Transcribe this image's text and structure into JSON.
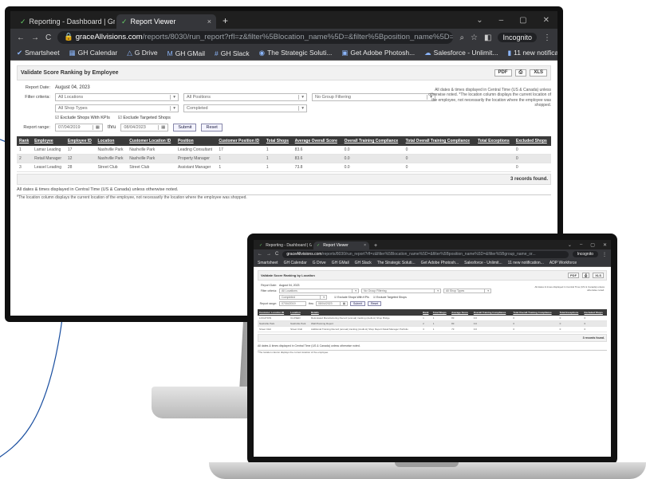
{
  "browser": {
    "tabs": [
      {
        "label": "Reporting - Dashboard | Grace I",
        "close": "×"
      },
      {
        "label": "Report Viewer",
        "close": "×"
      }
    ],
    "new_tab": "+",
    "window_controls": [
      "⌄",
      "–",
      "▢",
      "✕"
    ],
    "nav": {
      "back": "←",
      "forward": "→",
      "reload": "C"
    },
    "url_host": "graceAllvisions.com",
    "url_rest": "/reports/8030/run_report?rfl=z&filter%5Blocation_name%5D=&filter%5Bposition_name%5D=&filter%5Bgroup_name_or...",
    "incognito": "Incognito",
    "bookmarks": [
      "Smartsheet",
      "GH Calendar",
      "G Drive",
      "GH GMail",
      "GH Slack",
      "The Strategic Soluti...",
      "Get Adobe Photosh...",
      "Salesforce - Unlimit...",
      "11 new notification...",
      "ADP Workforce"
    ]
  },
  "monitor": {
    "title": "Validate Score Ranking by Employee",
    "title_buttons": [
      "PDF",
      "⎙",
      "XLS"
    ],
    "report_date_label": "Report Date:",
    "report_date": "August 04, 2023",
    "filter_label": "Filter criteria:",
    "filters": {
      "locations": "All Locations",
      "positions": "All Positions",
      "group": "No Group Filtering",
      "shop_types": "All Shop Types",
      "status": "Completed"
    },
    "checkboxes": [
      "Exclude Shops With KPIs",
      "Exclude Targeted Shops"
    ],
    "range_label": "Report range:",
    "date_from": "07/04/2019",
    "thru": "thru",
    "date_to": "08/04/2023",
    "submit": "Submit",
    "reset": "Reset",
    "right_note": "All dates & times displayed in Central Time (US & Canada) unless otherwise noted. *The location column displays the current location of the employee, not necessarily the location where the employee was shopped.",
    "columns": [
      "Rank",
      "Employee",
      "Employee ID",
      "Location",
      "Customer Location ID",
      "Position",
      "Customer Position ID",
      "Total Shops",
      "Average Overall Score",
      "Overall Training Compliance",
      "Total Overall Training Compliance",
      "Total Exceptions",
      "Excluded Shops"
    ],
    "rows": [
      [
        "1",
        "Lamar Leading",
        "17",
        "Nashville Park",
        "Nashville Park",
        "Leading Consultant",
        "17",
        "1",
        "83.6",
        "0.0",
        "0",
        "",
        "0"
      ],
      [
        "2",
        "Retail Manager",
        "12",
        "Nashville Park",
        "Nashville Park",
        "Property Manager",
        "1",
        "1",
        "83.6",
        "0.0",
        "0",
        "",
        "0"
      ],
      [
        "3",
        "Leasel Leading",
        "28",
        "Street Club",
        "Street Club",
        "Assistant Manager",
        "1",
        "1",
        "73.8",
        "0.0",
        "0",
        "",
        "0"
      ]
    ],
    "found": "3 records found.",
    "footer1": "All dates & times displayed in Central Time (US & Canada) unless otherwise noted.",
    "footer2": "*The location column displays the current location of the employee, not necessarily the location where the employee was shopped."
  },
  "laptop": {
    "title": "Validate Score Ranking by Location",
    "title_buttons": [
      "PDF",
      "⎙",
      "XLS"
    ],
    "report_date_label": "Report Date:",
    "report_date": "August 04, 2023",
    "filter_label": "Filter criteria:",
    "filters": {
      "locations": "All Locations",
      "group": "No Group Filtering",
      "positions": "All Shop Types",
      "status": "Completed"
    },
    "checkboxes": [
      "Exclude Shops With KPIs",
      "Exclude Targeted Shops"
    ],
    "range_label": "Report range:",
    "date_from": "07/04/2019",
    "thru": "thru",
    "date_to": "08/04/2023",
    "submit": "Submit",
    "reset": "Reset",
    "right_note": "All dates & times displayed in Central Time (US & Canada) unless otherwise noted.",
    "columns": [
      "Customer Location ID",
      "Location",
      "Details",
      "Rank",
      "Total Shops",
      "Average Score",
      "Overall Training Compliance",
      "Total Overall Training Compliance",
      "Total Exceptions",
      "Excluded Shops"
    ],
    "rows": [
      [
        "LOCATION",
        "CLOSED",
        "Reticulated Manufacturing Record (annual) tracking (Audit-H) Shop Bridge",
        "1",
        "1",
        "83",
        "0.0",
        "0",
        "0",
        "0"
      ],
      [
        "Nashville Park",
        "Nashville Park",
        "Wall Planning Report",
        "2",
        "1",
        "83",
        "0.0",
        "0",
        "0",
        "0"
      ],
      [
        "Street Club",
        "Street Club",
        "Additional Training Record (annual) tracking (Audit-H) Shop Report Retail Manager Portfolio",
        "3",
        "1",
        "73",
        "0.0",
        "0",
        "0",
        "0"
      ]
    ],
    "found": "3 records found.",
    "footer1": "All dates & times displayed in Central Time (US & Canada) unless otherwise noted.",
    "footer2": "*The location column displays the current location of the employee."
  }
}
